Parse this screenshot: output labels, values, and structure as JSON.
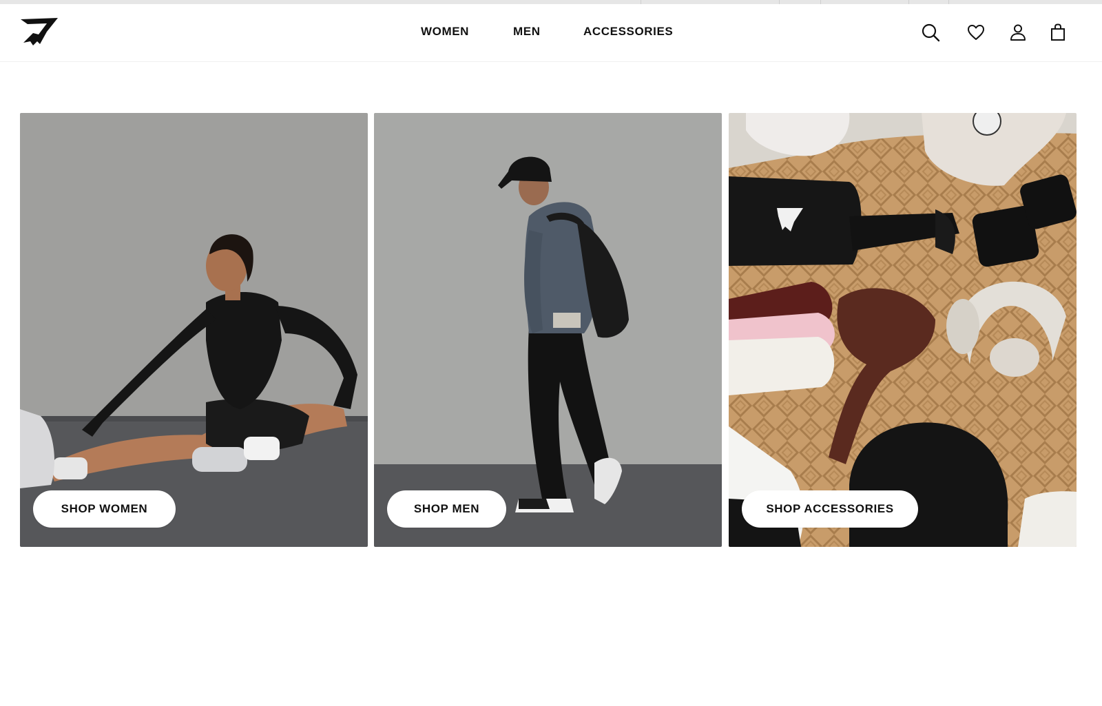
{
  "header": {
    "logo_name": "gymshark-logo",
    "nav": [
      {
        "label": "WOMEN"
      },
      {
        "label": "MEN"
      },
      {
        "label": "ACCESSORIES"
      }
    ],
    "icons": [
      "search-icon",
      "heart-icon",
      "account-icon",
      "bag-icon"
    ]
  },
  "cards": [
    {
      "cta": "SHOP WOMEN",
      "image": "woman stretching on floor in black activewear"
    },
    {
      "cta": "SHOP MEN",
      "image": "man in cap, hoodie and backpack walking"
    },
    {
      "cta": "SHOP ACCESSORIES",
      "image": "flat lay of caps, bag, socks, scrunchie, headphones, beanie on rug"
    }
  ],
  "colors": {
    "text": "#111111",
    "background": "#ffffff",
    "wall_gray": "#9a9a98",
    "floor_gray": "#5a5b5d",
    "rug_tan": "#c79a68"
  }
}
